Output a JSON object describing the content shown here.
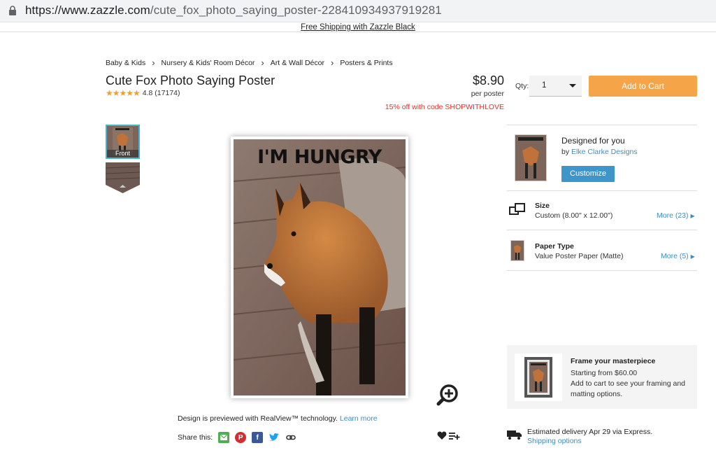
{
  "browser": {
    "url_host": "https://www.zazzle.com",
    "url_path": "/cute_fox_photo_saying_poster-228410934937919281"
  },
  "promo": {
    "text": "Free Shipping with Zazzle Black"
  },
  "breadcrumb": [
    "Baby & Kids",
    "Nursery & Kids' Room Décor",
    "Art & Wall Décor",
    "Posters & Prints"
  ],
  "product": {
    "title": "Cute Fox Photo Saying Poster",
    "stars": "★★★★★",
    "rating": "4.8 (17174)",
    "price": "$8.90",
    "per": "per poster",
    "discount": "15% off with code SHOPWITHLOVE",
    "poster_text": "I'M HUNGRY"
  },
  "purchase": {
    "qty_label": "Qty:",
    "qty_value": "1",
    "add_to_cart": "Add to Cart"
  },
  "thumbnails": {
    "front_label": "Front"
  },
  "preview": {
    "realview_text": "Design is previewed with RealView™ technology.",
    "learn_more": "Learn more",
    "share_label": "Share this:"
  },
  "design": {
    "title": "Designed for you",
    "by_prefix": "by",
    "designer": "Elke Clarke Designs",
    "customize": "Customize"
  },
  "options": {
    "size": {
      "title": "Size",
      "value": "Custom (8.00\" x 12.00\")",
      "more": "More (23)"
    },
    "paper": {
      "title": "Paper Type",
      "value": "Value Poster Paper (Matte)",
      "more": "More (5)"
    }
  },
  "frame": {
    "title": "Frame your masterpiece",
    "price": "Starting from $60.00",
    "desc": "Add to cart to see your framing and matting options."
  },
  "delivery": {
    "text": "Estimated delivery Apr 29 via Express.",
    "shipping_options": "Shipping options"
  },
  "colors": {
    "accent": "#f5a447",
    "link": "#3e8ebd",
    "sale": "#e5322d",
    "customize": "#3d95c9"
  }
}
